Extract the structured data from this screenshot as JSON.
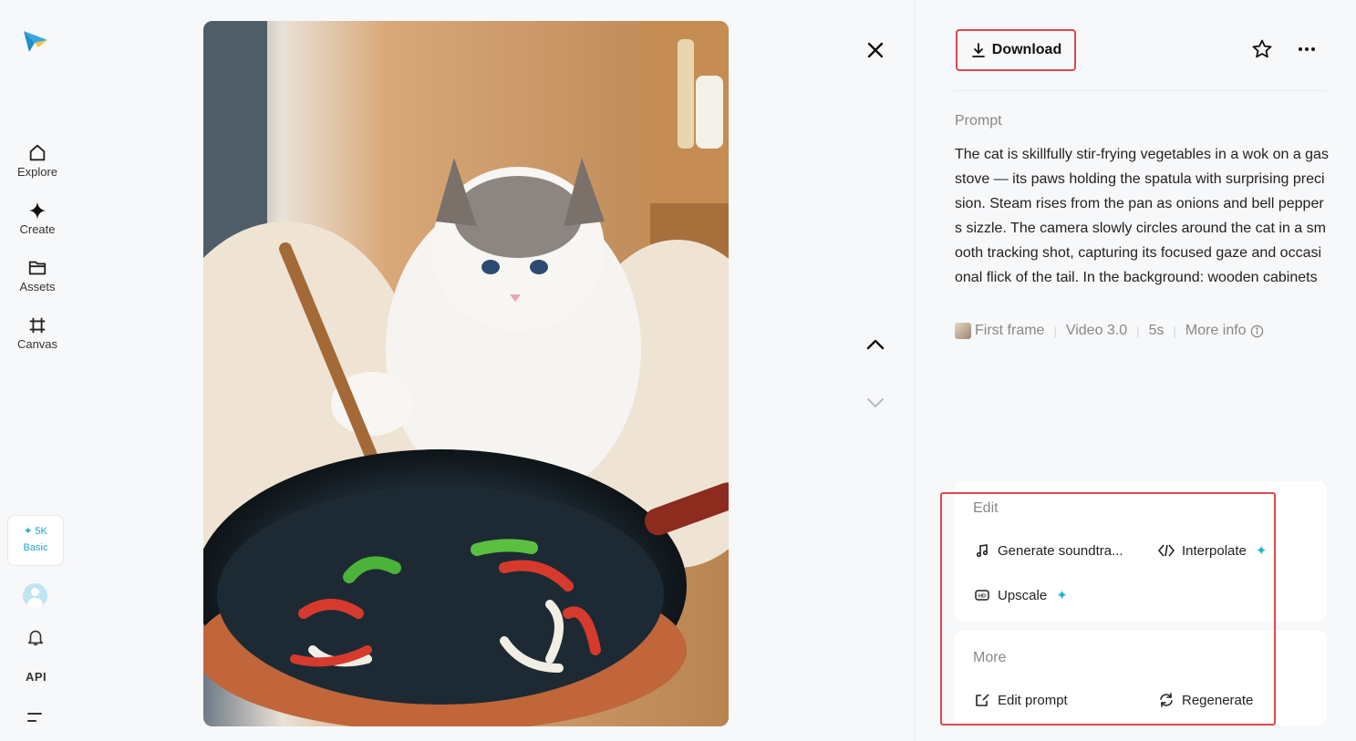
{
  "sidebar": {
    "logo": "paper-plane-logo",
    "items": [
      {
        "label": "Explore",
        "icon": "home-icon"
      },
      {
        "label": "Create",
        "icon": "sparkle-icon"
      },
      {
        "label": "Assets",
        "icon": "folder-icon"
      },
      {
        "label": "Canvas",
        "icon": "crop-icon"
      }
    ],
    "credits": {
      "amount": "✦ 5K",
      "plan": "Basic"
    },
    "api_label": "API"
  },
  "header": {
    "download_label": "Download"
  },
  "prompt": {
    "label": "Prompt",
    "text": "The cat is skillfully stir-frying vegetables in a wok on a gas stove — its paws holding the spatula with surprising precision. Steam rises from the pan as onions and bell peppers sizzle. The camera slowly circles around the cat in a smooth tracking shot, capturing its focused gaze and occasional flick of the tail. In the background: wooden cabinets"
  },
  "meta": {
    "first_frame": "First frame",
    "model": "Video 3.0",
    "duration": "5s",
    "more_info": "More info"
  },
  "edit": {
    "title": "Edit",
    "generate_soundtrack": "Generate soundtra...",
    "interpolate": "Interpolate",
    "upscale": "Upscale"
  },
  "more": {
    "title": "More",
    "edit_prompt": "Edit prompt",
    "regenerate": "Regenerate"
  },
  "colors": {
    "accent": "#19b6d2",
    "highlight": "#e0484e"
  }
}
